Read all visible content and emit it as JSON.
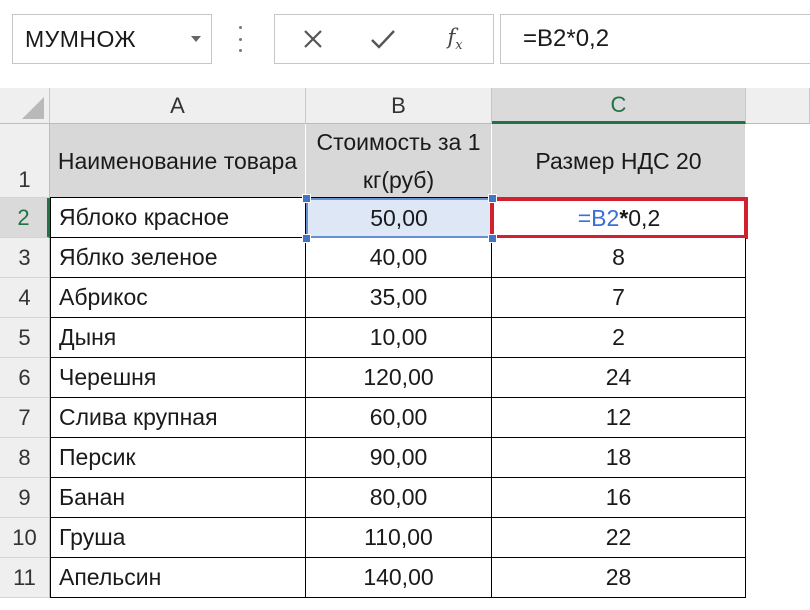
{
  "formula_bar": {
    "name_box": "МУМНОЖ",
    "formula_value": "=B2*0,2",
    "fx_label": "f",
    "fx_sub": "x"
  },
  "columns": [
    "A",
    "B",
    "C"
  ],
  "active_column": "C",
  "rows": [
    "1",
    "2",
    "3",
    "4",
    "5",
    "6",
    "7",
    "8",
    "9",
    "10",
    "11"
  ],
  "active_row": "2",
  "header": {
    "a": "Наименование товара",
    "b": "Стоимость за 1 кг(руб)",
    "c": "Размер НДС 20"
  },
  "edit_cell": {
    "eq": "=",
    "ref": "B2",
    "op": "*",
    "rest": "0,2"
  },
  "data": [
    {
      "name": "Яблоко красное",
      "price": "50,00",
      "vat": ""
    },
    {
      "name": "Яблко зеленое",
      "price": "40,00",
      "vat": "8"
    },
    {
      "name": "Абрикос",
      "price": "35,00",
      "vat": "7"
    },
    {
      "name": "Дыня",
      "price": "10,00",
      "vat": "2"
    },
    {
      "name": "Черешня",
      "price": "120,00",
      "vat": "24"
    },
    {
      "name": "Слива крупная",
      "price": "60,00",
      "vat": "12"
    },
    {
      "name": "Персик",
      "price": "90,00",
      "vat": "18"
    },
    {
      "name": "Банан",
      "price": "80,00",
      "vat": "16"
    },
    {
      "name": "Груша",
      "price": "110,00",
      "vat": "22"
    },
    {
      "name": "Апельсин",
      "price": "140,00",
      "vat": "28"
    }
  ],
  "colors": {
    "selection_border": "#4472c4",
    "edit_border": "#d3202e",
    "active_header_green": "#217346"
  }
}
